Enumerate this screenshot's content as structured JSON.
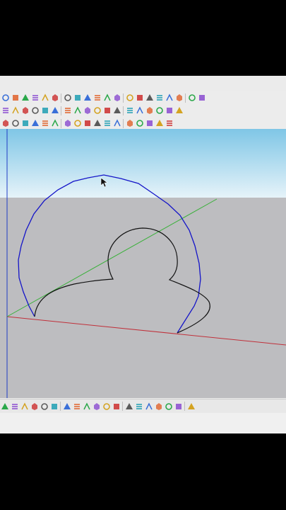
{
  "colors": {
    "sky_top": "#7fc6e6",
    "sky_bottom": "#e6f3f9",
    "ground": "#bdbdc0",
    "axis_red": "#c0303a",
    "axis_green": "#38b038",
    "axis_blue": "#1f3cc4",
    "edge_blue": "#1414c8",
    "edge_black": "#111111"
  },
  "toolbars": {
    "row1": [
      "zoom-icon",
      "erase-icon",
      "orbit-icon",
      "tape-icon",
      "section-icon",
      "section-plane-icon",
      "walk-icon",
      "play-icon",
      "stop-icon",
      "prev-scene-icon",
      "next-scene-icon",
      "measure-icon",
      "axis-icon",
      "iso-view-icon",
      "front-view-icon",
      "camera-icon",
      "photo-icon",
      "settings-icon",
      "box-icon",
      "cube-icon"
    ],
    "row2": [
      "cut-fill-icon",
      "component-icon",
      "dye-icon",
      "terrain-icon",
      "stamp-icon",
      "drape-icon",
      "paint-icon",
      "book-icon",
      "ar-icon",
      "ring-icon",
      "style-icon",
      "gear-icon",
      "node-icon",
      "stack-icon",
      "table-icon",
      "frame-icon",
      "color-icon",
      "grid-icon"
    ],
    "row3": [
      "frame-a-icon",
      "frame-b-icon",
      "frame-c-icon",
      "frame-d-icon",
      "frame-e-icon",
      "frame-f-icon",
      "frame-g-icon",
      "frame-h-icon",
      "frame-i-icon",
      "frame-j-icon",
      "plugin-icon",
      "bubbles-icon",
      "roof-a-icon",
      "roof-b-icon",
      "roof-c-icon",
      "roof-d-icon",
      "roof-e-icon"
    ],
    "bottom": [
      "push-icon",
      "arrow-left-icon",
      "arrow-right-icon",
      "pen-icon",
      "line-tool-icon",
      "rect-icon",
      "pair-icon",
      "rotate-icon",
      "flip-icon",
      "mirror-icon",
      "move-icon",
      "align-icon",
      "scale-icon",
      "drop-icon",
      "fill-icon",
      "person-icon",
      "extension-icon",
      "warehouse-icon",
      "settings-icon"
    ]
  }
}
